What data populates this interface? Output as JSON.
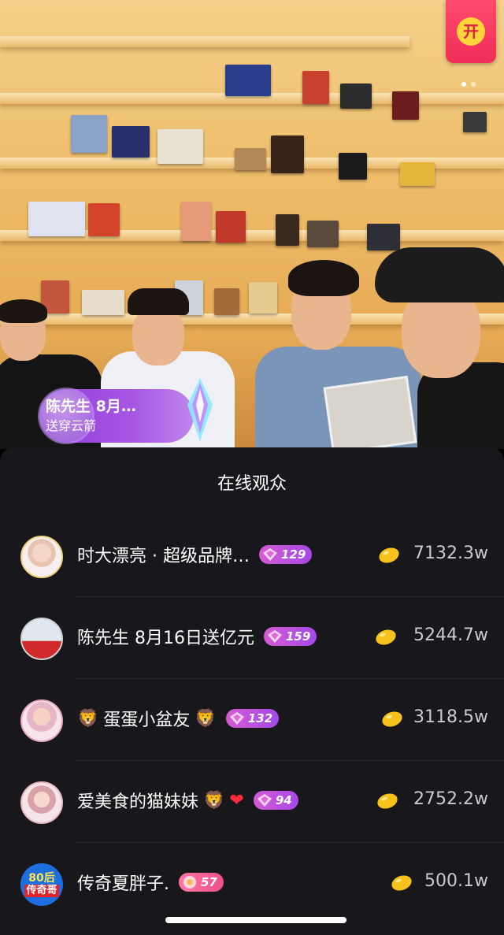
{
  "live_room": {
    "red_packet_label": "开",
    "gift_notice": {
      "sender": "陈先生 8月…",
      "action": "送穿云箭"
    }
  },
  "audience_panel": {
    "title": "在线观众",
    "viewers": [
      {
        "name": "时大漂亮 · 超级品牌…",
        "level": "129",
        "coins": "7132.3w",
        "avatar_color": "#f5e9ec",
        "emoji_after": [],
        "level_style": "high"
      },
      {
        "name": "陈先生 8月16日送亿元",
        "level": "159",
        "coins": "5244.7w",
        "avatar_color": "#dfe6ef",
        "emoji_after": [],
        "level_style": "high"
      },
      {
        "name": "蛋蛋小盆友",
        "level": "132",
        "coins": "3118.5w",
        "avatar_color": "#f7d9e2",
        "emoji_before": "lion-icon",
        "emoji_after": [
          "lion-icon"
        ],
        "level_style": "high"
      },
      {
        "name": "爱美食的猫妹妹",
        "level": "94",
        "coins": "2752.2w",
        "avatar_color": "#f4e3e5",
        "emoji_after": [
          "lion-icon",
          "heart-icon"
        ],
        "level_style": "high"
      },
      {
        "name": "传奇夏胖子.",
        "level": "57",
        "coins": "500.1w",
        "avatar_color": "#1d6fe0",
        "emoji_after": [],
        "level_style": "low",
        "avatar_text_top": "80后",
        "avatar_text_bottom": "传奇哥"
      }
    ]
  }
}
